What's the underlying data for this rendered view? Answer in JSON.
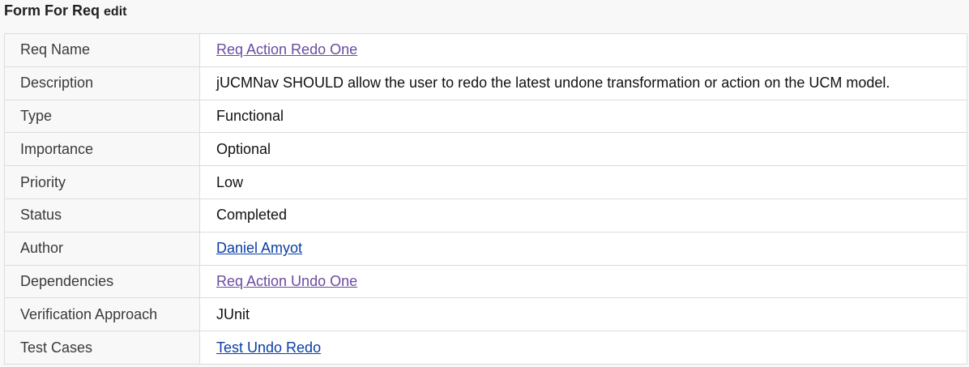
{
  "header": {
    "title": "Form For Req",
    "edit_label": "edit"
  },
  "rows": [
    {
      "label": "Req Name",
      "value": "Req Action Redo One",
      "kind": "link-visited"
    },
    {
      "label": "Description",
      "value": "jUCMNav SHOULD allow the user to redo the latest undone transformation or action on the UCM model.",
      "kind": "text"
    },
    {
      "label": "Type",
      "value": "Functional",
      "kind": "text"
    },
    {
      "label": "Importance",
      "value": "Optional",
      "kind": "text"
    },
    {
      "label": "Priority",
      "value": "Low",
      "kind": "text"
    },
    {
      "label": "Status",
      "value": "Completed",
      "kind": "text"
    },
    {
      "label": "Author",
      "value": "Daniel Amyot",
      "kind": "link"
    },
    {
      "label": "Dependencies",
      "value": "Req Action Undo One",
      "kind": "link-visited"
    },
    {
      "label": "Verification Approach",
      "value": "JUnit",
      "kind": "text"
    },
    {
      "label": "Test Cases",
      "value": "Test Undo Redo",
      "kind": "link"
    }
  ],
  "colors": {
    "link": "#0b3fa3",
    "visited_link": "#6b4ba1",
    "border": "#dcdcdc",
    "page_background": "#f8f8f8"
  }
}
